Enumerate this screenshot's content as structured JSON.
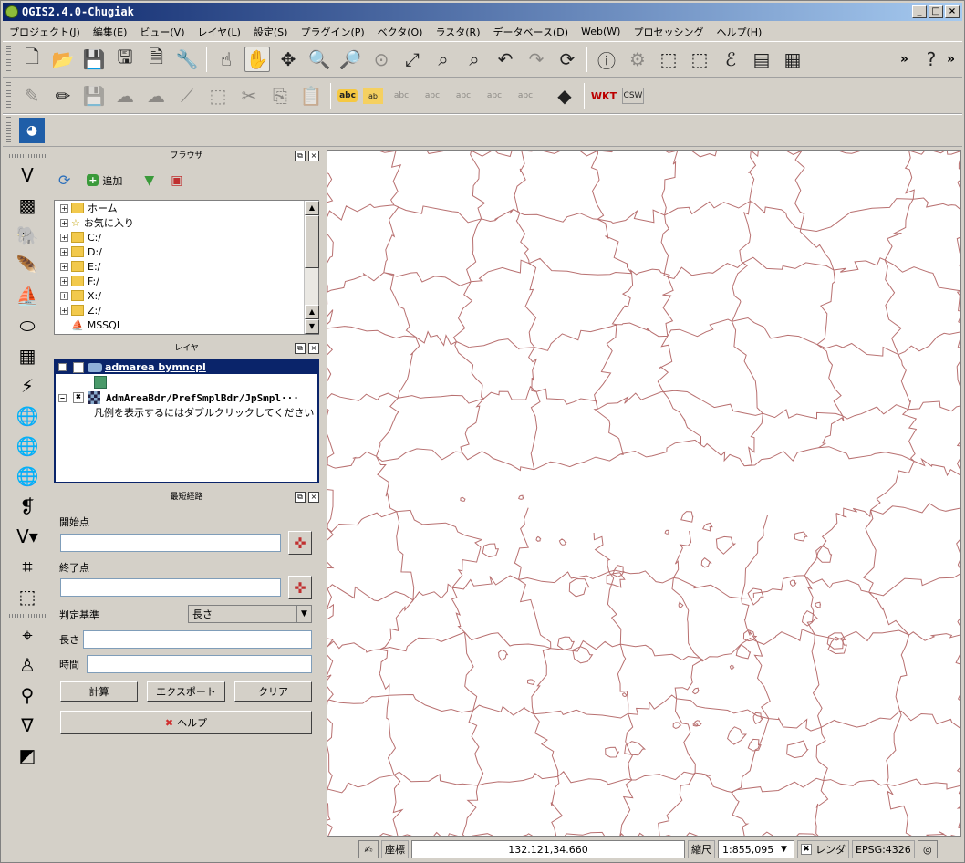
{
  "window": {
    "title": "QGIS2.4.0-Chugiak",
    "min": "_",
    "max": "□",
    "close": "×"
  },
  "menu": [
    "プロジェクト(J)",
    "編集(E)",
    "ビュー(V)",
    "レイヤ(L)",
    "設定(S)",
    "プラグイン(P)",
    "ベクタ(O)",
    "ラスタ(R)",
    "データベース(D)",
    "Web(W)",
    "プロセッシング",
    "ヘルプ(H)"
  ],
  "toolbar": {
    "overflow": "»",
    "abc": "abc",
    "csw": "CSW",
    "wkt": "WKT"
  },
  "browser": {
    "title": "ブラウザ",
    "add_label": "追加",
    "items": [
      "ホーム",
      "お気に入り",
      "C:/",
      "D:/",
      "E:/",
      "F:/",
      "X:/",
      "Z:/",
      "MSSQL"
    ]
  },
  "layers": {
    "title": "レイヤ",
    "items": [
      {
        "name": "admarea bymncpl",
        "checked": false,
        "selected": true
      },
      {
        "name": "AdmAreaBdr/PrefSmplBdr/JpSmpl···",
        "checked": true,
        "selected": false
      }
    ],
    "legend_hint": "凡例を表示するにはダブルクリックしてください"
  },
  "route": {
    "title": "最短経路",
    "start_label": "開始点",
    "end_label": "終了点",
    "criterion_label": "判定基準",
    "criterion_value": "長さ",
    "length_label": "長さ",
    "time_label": "時間",
    "calc_button": "計算",
    "export_button": "エクスポート",
    "clear_button": "クリア",
    "help_button": "ヘルプ"
  },
  "status": {
    "coord_label": "座標",
    "coord_value": "132.121,34.660",
    "scale_label": "縮尺",
    "scale_value": "1:855,095",
    "render_label": "レンダ",
    "crs": "EPSG:4326"
  },
  "colors": {
    "map_boundary": "#b87070",
    "selection": "#0a246a"
  }
}
